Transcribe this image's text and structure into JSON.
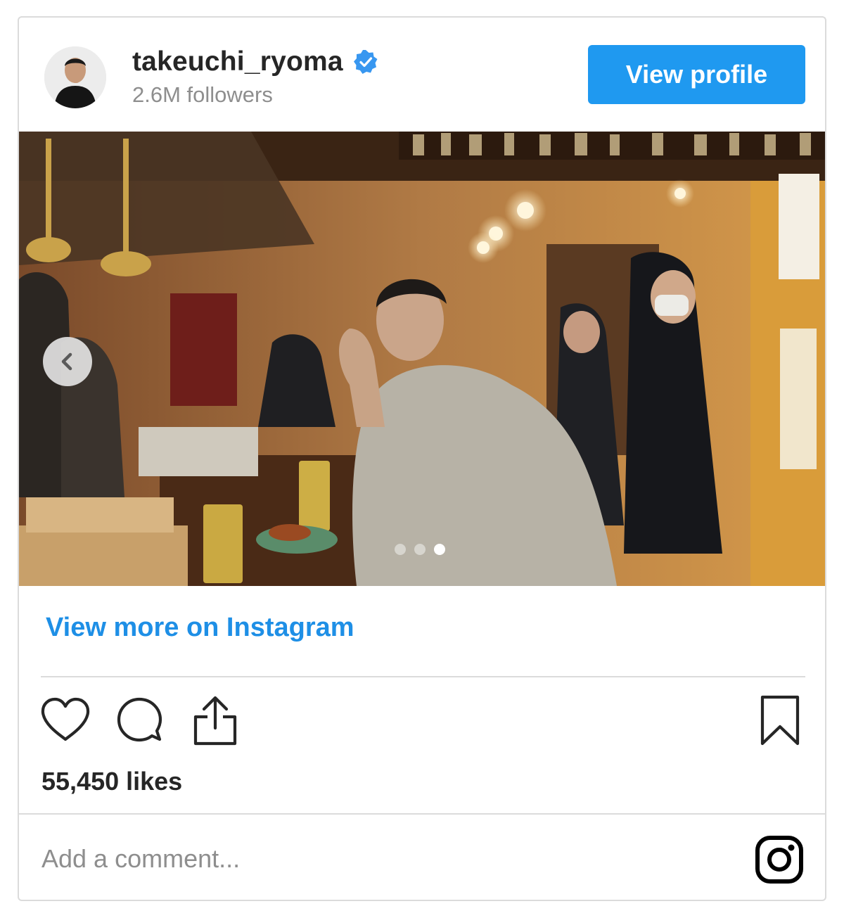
{
  "header": {
    "username": "takeuchi_ryoma",
    "verified": true,
    "followers": "2.6M followers",
    "view_profile_label": "View profile"
  },
  "post": {
    "carousel": {
      "total": 3,
      "active_index": 2
    },
    "view_more_label": "View more on Instagram",
    "likes": "55,450 likes",
    "comment_placeholder": "Add a comment..."
  },
  "colors": {
    "button_blue": "#1f99f0",
    "link_blue": "#1e8fe6",
    "text_dark": "#262626",
    "text_gray": "#8e8e8e",
    "border": "#dbdbdb"
  },
  "icons": {
    "verified": "verified-badge-icon",
    "prev": "chevron-left-icon",
    "like": "heart-icon",
    "comment": "comment-bubble-icon",
    "share": "share-icon",
    "save": "bookmark-icon",
    "logo": "instagram-logo-icon"
  }
}
